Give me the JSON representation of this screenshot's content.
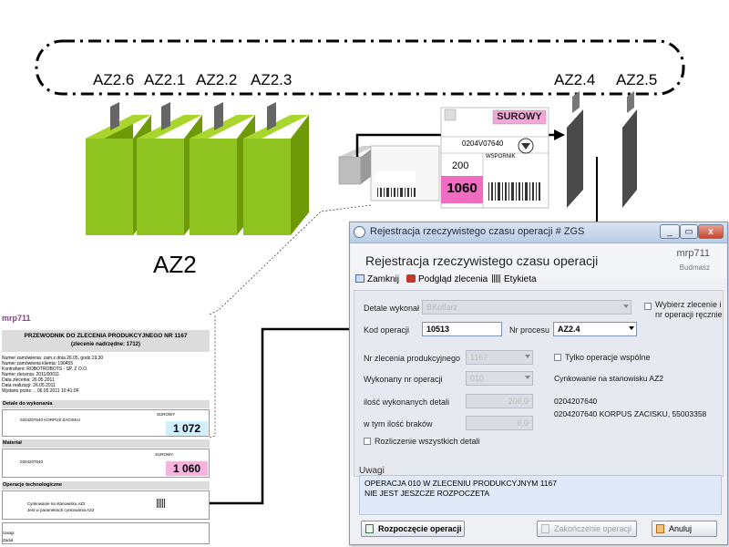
{
  "zones": {
    "top": [
      "AZ2.6",
      "AZ2.1",
      "AZ2.2",
      "AZ2.3"
    ],
    "right": [
      "AZ2.4",
      "AZ2.5"
    ],
    "group_label": "AZ2"
  },
  "label_card": {
    "status": "SUROWY",
    "code": "0204V07640",
    "qty": "200",
    "type": "WSPORNIK",
    "number": "1060"
  },
  "window": {
    "title": "Rejestracja rzeczywistego czasu operacji # ZGS",
    "controls": [
      "_",
      "▭",
      "x"
    ],
    "header_title": "Rejestracja rzeczywistego czasu operacji",
    "app": "mrp711",
    "company": "Budmasz",
    "toolbar": {
      "close": "Zamknij",
      "preview": "Podgląd zlecenia",
      "label": "Etykieta"
    },
    "form": {
      "executor_label": "Detale wykonał",
      "executor_value": "BKotlarz",
      "pick_order_label": "Wybierz zlecenie i nr operacji ręcznie",
      "op_code_label": "Kod operacji",
      "op_code_value": "10513",
      "process_label": "Nr procesu",
      "process_value": "AZ2.4",
      "order_label": "Nr zlecenia produkcyjnego",
      "order_value": "1167",
      "shared_only_label": "Tylko operacje wspólne",
      "op_done_label": "Wykonany nr operacji",
      "op_done_value": "010",
      "station_info": "Cynkowanie na stanowisku AZ2",
      "qty_done_label": "ilość wykonanych detali",
      "qty_done_value": "200,0",
      "part_code": "0204207640",
      "defects_label": "w tym ilość braków",
      "defects_value": "0,0",
      "part_desc": "0204207640 KORPUS ZACISKU, 55003358",
      "settle_all_label": "Rozliczenie wszystkich detali"
    },
    "notes_label": "Uwagi",
    "notes_text": [
      "OPERACJA 010 W ZLECENIU PRODUKCYJNYM 1167",
      "NIE JEST JESZCZE ROZPOCZETA"
    ],
    "buttons": {
      "start": "Rozpoczęcie operacji",
      "finish": "Zakończenie operacji",
      "cancel": "Anuluj"
    }
  },
  "document": {
    "brand": "mrp711",
    "title": "PRZEWODNIK DO ZLECENIA PRODUKCYJNEGO NR 1167",
    "subtitle": "(zlecenie nadrzędne: 1712)",
    "meta": [
      "Numer zamówienia:  zam.z dnia 26.05. godz.19,30",
      "Numer zamówienia klienta:  190455",
      "Kontrahent:  ROBOTROBOTS - SP. Z O.O.",
      "Numer zlecenia:  2011/00011",
      "Data zlecenia:  26.05.2011",
      "Data realizacji:  26.05.2011",
      "Wydano przez: ..  06.05.2011 10:41:0F"
    ],
    "section1": "Detale do wykonania",
    "section1_row": "0204207640 KORPUS ZACISKU",
    "section1_value": "1 072",
    "section1_status": "SUROWY",
    "section2": "Materiał",
    "section2_row": "0204207640",
    "section2_value": "1 060",
    "section2_status": "SUROWY",
    "section3": "Operacje technologiczne",
    "section3_row": "Cynkowanie na stanowisku AZ2",
    "section3_row2": "Jest w parametrach cynkowania AZ2",
    "footer": [
      "Uwagi",
      "Zadoł"
    ]
  }
}
